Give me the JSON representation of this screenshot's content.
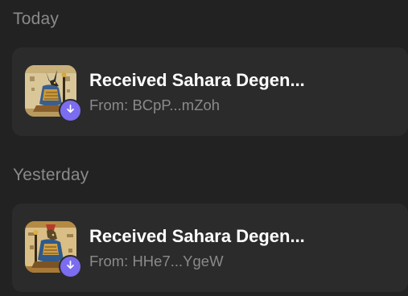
{
  "sections": [
    {
      "header": "Today",
      "items": [
        {
          "title": "Received Sahara Degen...",
          "from": "From: BCpP...mZoh",
          "thumb_icon": "nft-anubis-thumbnail",
          "badge_icon": "receive-arrow-down-icon"
        }
      ]
    },
    {
      "header": "Yesterday",
      "items": [
        {
          "title": "Received Sahara Degen...",
          "from": "From: HHe7...YgeW",
          "thumb_icon": "nft-horus-thumbnail",
          "badge_icon": "receive-arrow-down-icon"
        }
      ]
    }
  ],
  "colors": {
    "background": "#222222",
    "card": "#2b2b2b",
    "badge": "#7b6cf0",
    "title": "#ffffff",
    "muted": "#8a8a8a"
  }
}
